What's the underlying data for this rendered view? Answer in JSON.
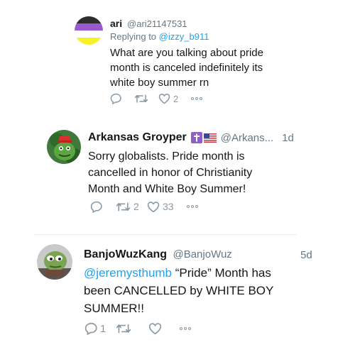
{
  "tweet1": {
    "name": "ari",
    "handle": "@ari21147531",
    "replying_label": "Replying to",
    "replying_to": "@izzy_b911",
    "text": "What are you talking about pride month is canceled indefinitely its white boy summer rn",
    "likes": "2",
    "avatar_colors": [
      "#f7f227",
      "#ffffff",
      "#9b59d0",
      "#2d2d2d"
    ]
  },
  "tweet2": {
    "name": "Arkansas Groyper",
    "handle": "@Arkans...",
    "time": "1d",
    "text": "Sorry globalists. Pride month is cancelled in honor of Christianity Month and White Boy Summer!",
    "retweets": "2",
    "likes": "33"
  },
  "tweet3": {
    "name": "BanjoWuzKang",
    "handle": "@BanjoWuz",
    "time": "5d",
    "mention": "@jeremysthumb",
    "text": " “Pride” Month has been CANCELLED by WHITE BOY SUMMER!!",
    "replies": "1"
  },
  "colors": {
    "accent": "#1da1f2",
    "muted": "#657786",
    "icon": "#8899a6"
  }
}
